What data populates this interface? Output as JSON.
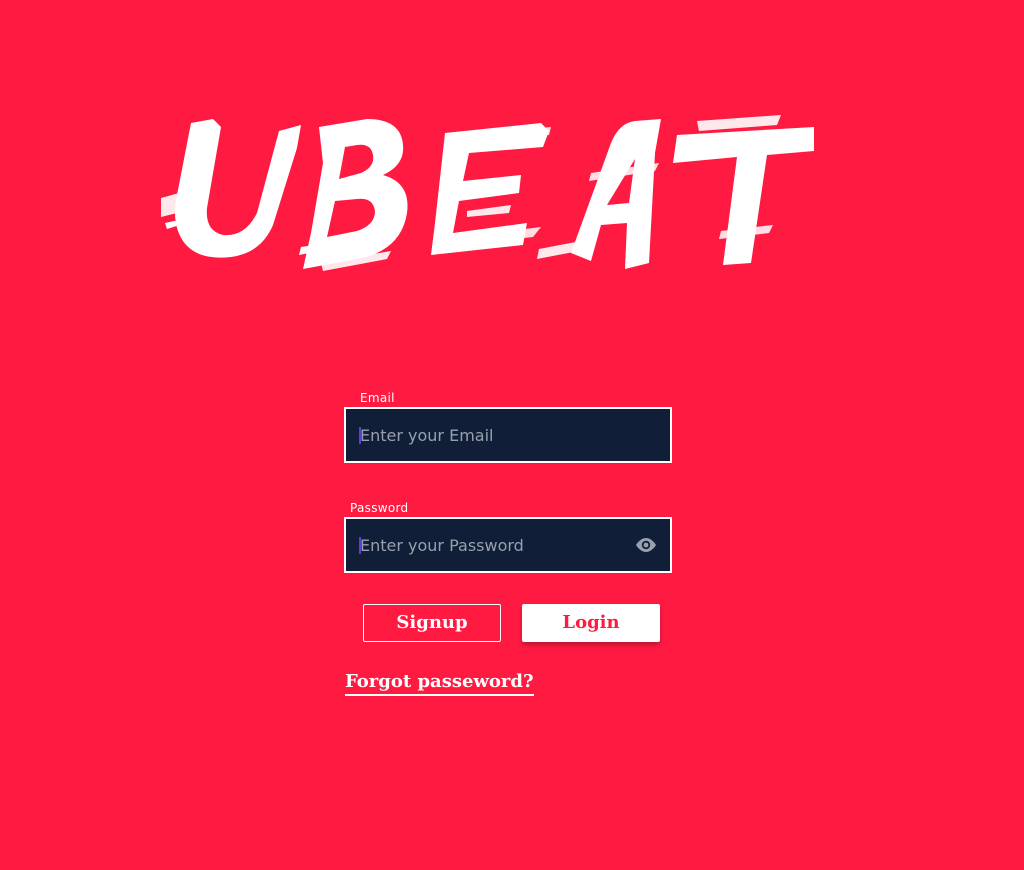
{
  "brand": {
    "logo_text": "UBEAT",
    "background_color": "#ff1a42",
    "logo_color": "#ffffff"
  },
  "form": {
    "email": {
      "label": "Email",
      "placeholder": "Enter your Email",
      "value": ""
    },
    "password": {
      "label": "Password",
      "placeholder": "Enter your Password",
      "value": "",
      "toggle_icon": "eye-icon"
    },
    "field_background": "#111e38"
  },
  "actions": {
    "signup_label": "Signup",
    "login_label": "Login",
    "forgot_label": "Forgot passeword?"
  }
}
